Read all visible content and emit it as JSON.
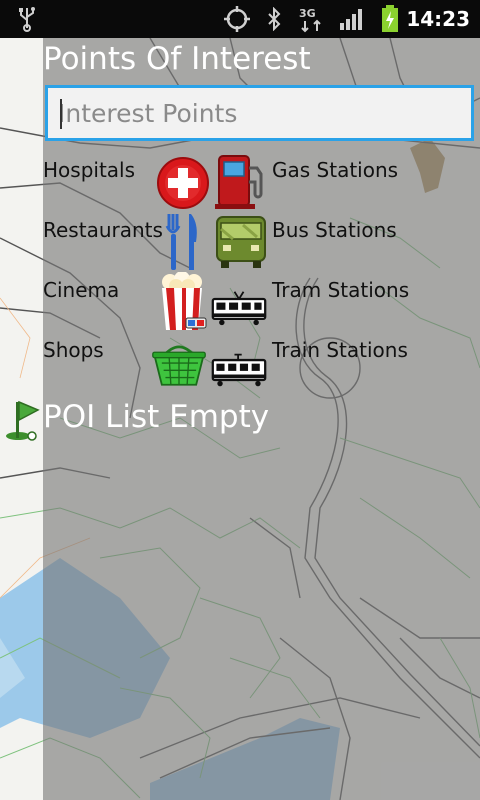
{
  "status_bar": {
    "time": "14:23",
    "network": "3G",
    "icons": [
      "usb-icon",
      "gps-icon",
      "bluetooth-icon",
      "data-3g-icon",
      "signal-icon",
      "battery-charging-icon"
    ]
  },
  "panel": {
    "title": "Points Of Interest",
    "search": {
      "value": "",
      "placeholder": "Interest Points"
    },
    "categories": [
      {
        "label": "Hospitals",
        "icon": "hospital-icon"
      },
      {
        "label": "Gas Stations",
        "icon": "gas-pump-icon"
      },
      {
        "label": "Restaurants",
        "icon": "fork-knife-icon"
      },
      {
        "label": "Bus Stations",
        "icon": "bus-icon"
      },
      {
        "label": "Cinema",
        "icon": "popcorn-icon"
      },
      {
        "label": "Tram Stations",
        "icon": "tram-icon"
      },
      {
        "label": "Shops",
        "icon": "shopping-basket-icon"
      },
      {
        "label": "Train Stations",
        "icon": "train-icon"
      }
    ],
    "empty_message": "POI List Empty"
  },
  "colors": {
    "status_bar": "#0a0a0a",
    "panel_overlay": "#787878",
    "search_border": "#2aa2e8",
    "map_background": "#f3f3f0",
    "map_roads": "#555555",
    "map_green_lines": "#7ec27e",
    "map_water": "#9cc9ea",
    "battery": "#8bd12f"
  }
}
